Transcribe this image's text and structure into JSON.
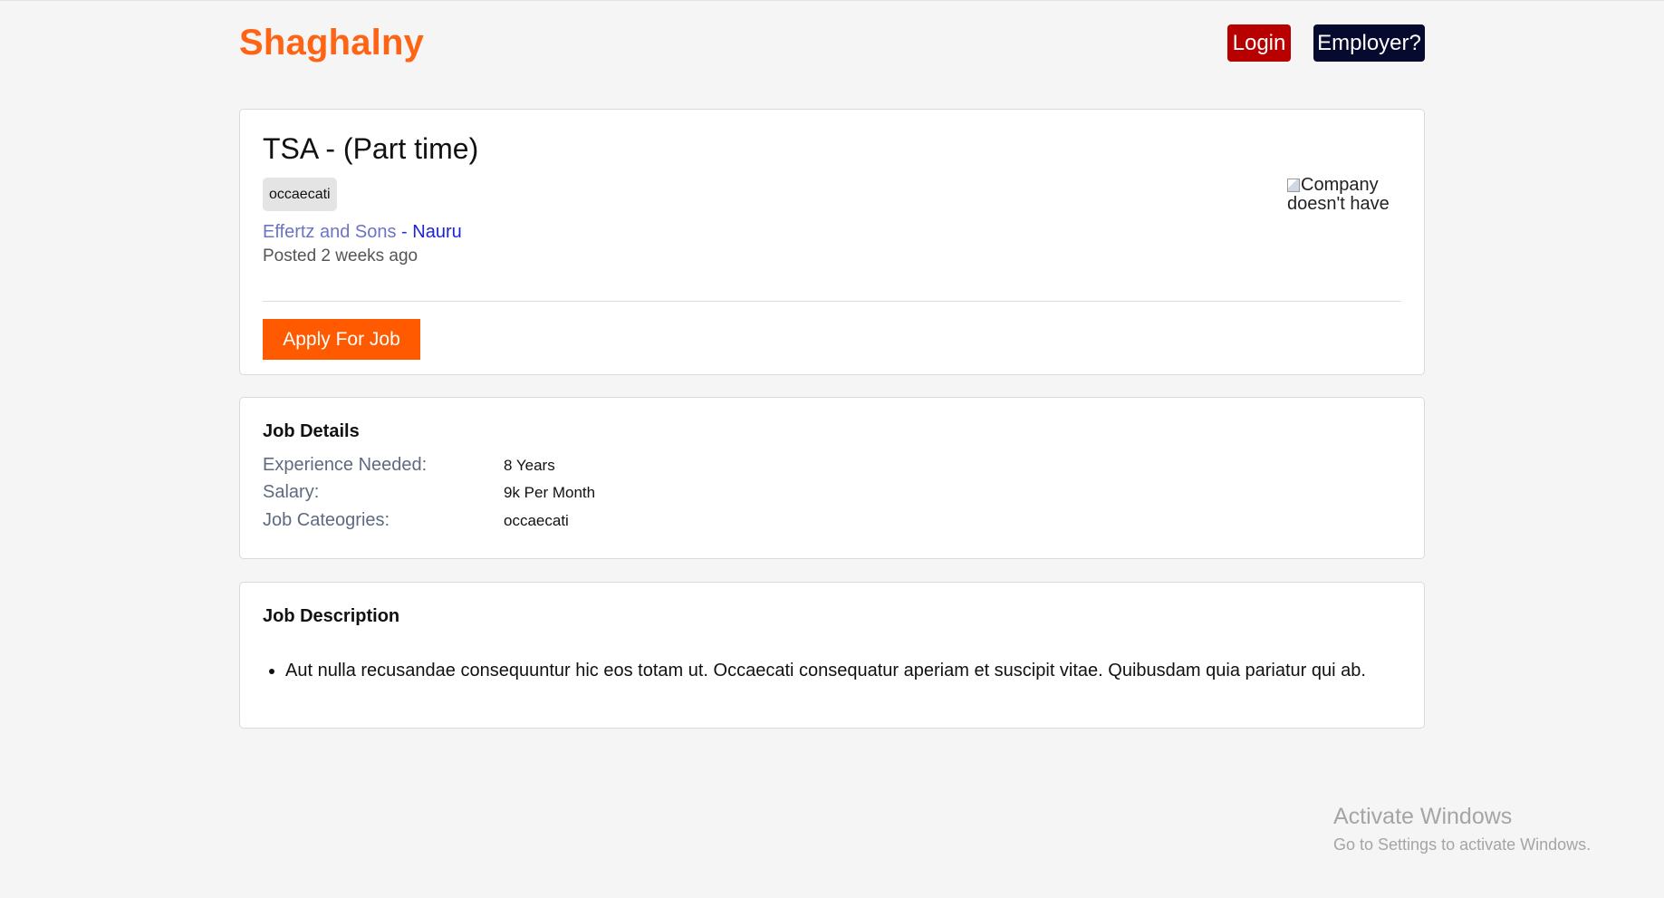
{
  "header": {
    "brand": "Shaghalny",
    "login_label": "Login",
    "employer_label": "Employer?"
  },
  "job": {
    "title": "TSA - (Part time)",
    "tag": "occaecati",
    "company": "Effertz and Sons",
    "separator": " - ",
    "location": "Nauru",
    "posted": "Posted 2 weeks ago",
    "logo_alt": "Company doesn't have",
    "apply_label": "Apply For Job"
  },
  "details": {
    "title": "Job Details",
    "rows": [
      {
        "label": "Experience Needed:",
        "value": "8 Years"
      },
      {
        "label": "Salary:",
        "value": "9k Per Month"
      },
      {
        "label": "Job Cateogries:",
        "value": "occaecati"
      }
    ]
  },
  "description": {
    "title": "Job Description",
    "items": [
      "Aut nulla recusandae consequuntur hic eos totam ut. Occaecati consequatur aperiam et suscipit vitae. Quibusdam quia pariatur qui ab."
    ]
  },
  "watermark": {
    "title": "Activate Windows",
    "subtitle": "Go to Settings to activate Windows."
  },
  "colors": {
    "brand": "#ff6314",
    "login_bg": "#b90000",
    "employer_bg": "#050a2e",
    "apply_bg": "#ff5a00",
    "link": "#1d24d8"
  }
}
